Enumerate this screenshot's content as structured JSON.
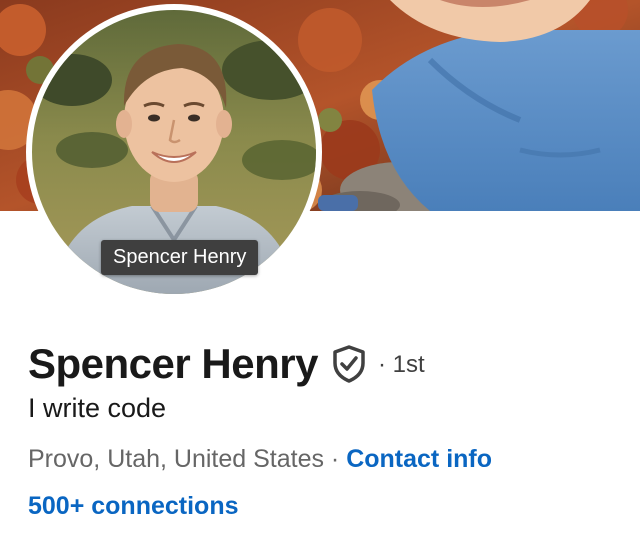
{
  "cover": {
    "icon": "cover-photo"
  },
  "avatar": {
    "tooltip": "Spencer Henry"
  },
  "profile": {
    "name": "Spencer Henry",
    "verified_icon": "verified-shield-icon",
    "degree": "· 1st",
    "headline": "I write code",
    "location": "Provo, Utah, United States",
    "separator": " · ",
    "contact_info": "Contact info",
    "connections": "500+ connections"
  },
  "colors": {
    "link": "#0a66c2",
    "name_text": "#191919",
    "secondary_text": "#666666",
    "tooltip_bg": "#3f3f3f"
  }
}
